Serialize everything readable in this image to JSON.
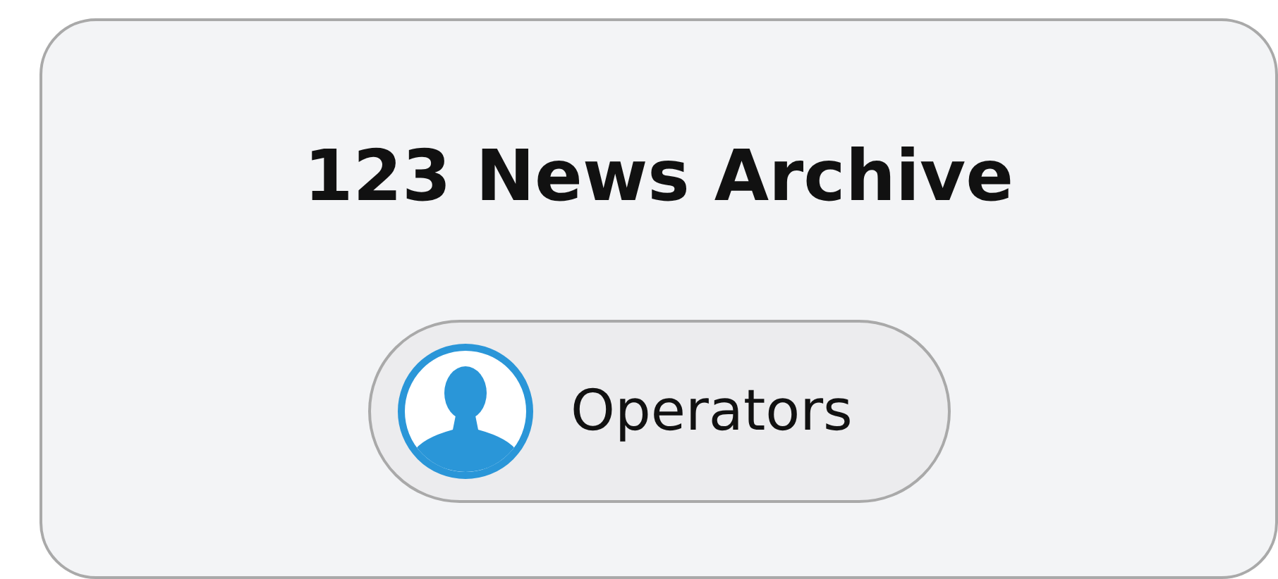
{
  "card": {
    "title": "123 News Archive"
  },
  "button": {
    "label": "Operators"
  }
}
